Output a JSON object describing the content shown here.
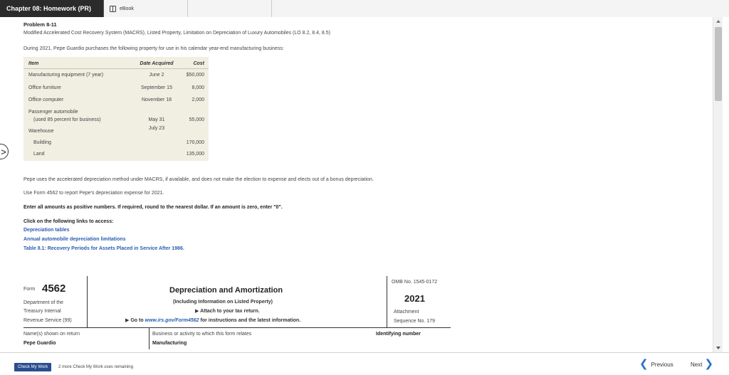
{
  "header": {
    "title": "Chapter 08: Homework (PR)",
    "tab_ebook": "eBook"
  },
  "problem": {
    "number": "Problem 8-11",
    "subtitle": "Modified Accelerated Cost Recovery System (MACRS), Listed Property, Limitation on Depreciation of Luxury Automobiles (LO 8.2, 8.4, 8.5)",
    "intro": "During 2021, Pepe Guardio purchases the following property for use in his calendar year-end manufacturing business:"
  },
  "table": {
    "headers": [
      "Item",
      "Date Acquired",
      "Cost"
    ],
    "rows": [
      {
        "item": "Manufacturing equipment (7 year)",
        "date": "June 2",
        "cost": "$50,000"
      },
      {
        "item": "Office furniture",
        "date": "September 15",
        "cost": "8,000"
      },
      {
        "item": "Office computer",
        "date": "November 18",
        "cost": "2,000"
      },
      {
        "item": "Passenger automobile",
        "date": "",
        "cost": ""
      },
      {
        "item": "(used 85 percent for business)",
        "date": "May 31",
        "cost": "55,000"
      },
      {
        "item": "Warehouse",
        "date": "July 23",
        "cost": ""
      },
      {
        "item": "Building",
        "date": "",
        "cost": "170,000"
      },
      {
        "item": "Land",
        "date": "",
        "cost": "135,000"
      }
    ]
  },
  "instructions": {
    "p1": "Pepe uses the accelerated depreciation method under MACRS, if available, and does not make the election to expense and elects out of a bonus depreciation.",
    "p2": "Use Form 4562 to report Pepe's depreciation expense for 2021.",
    "p3": "Enter all amounts as positive numbers. If required, round to the nearest dollar. If an amount is zero, enter \"0\".",
    "links_header": "Click on the following links to access:",
    "links": [
      "Depreciation tables",
      "Annual automobile depreciation limitations",
      "Table 8.1: Recovery Periods for Assets Placed in Service After 1986."
    ]
  },
  "form": {
    "form_word": "Form",
    "form_number": "4562",
    "dept1": "Department of the",
    "dept2": "Treasury Internal",
    "dept3": "Revenue Service (99)",
    "title": "Depreciation and Amortization",
    "sub1": "(Including Information on Listed Property)",
    "sub2": "▶ Attach to your tax return.",
    "sub3_prefix": "▶ Go to ",
    "sub3_link": "www.irs.gov/Form4562",
    "sub3_suffix": " for instructions and the latest information.",
    "omb": "OMB No. 1545-0172",
    "year": "2021",
    "attachment": "Attachment",
    "sequence": "Sequence No. 179",
    "names_label": "Name(s) shown on return",
    "names_value": "Pepe Guardio",
    "business_label": "Business or activity to which this form relates",
    "business_value": "Manufacturing",
    "id_label": "Identifying number"
  },
  "footer": {
    "check_label": "Check My Work",
    "remaining": "2 more Check My Work uses remaining",
    "previous": "Previous",
    "next": "Next"
  }
}
